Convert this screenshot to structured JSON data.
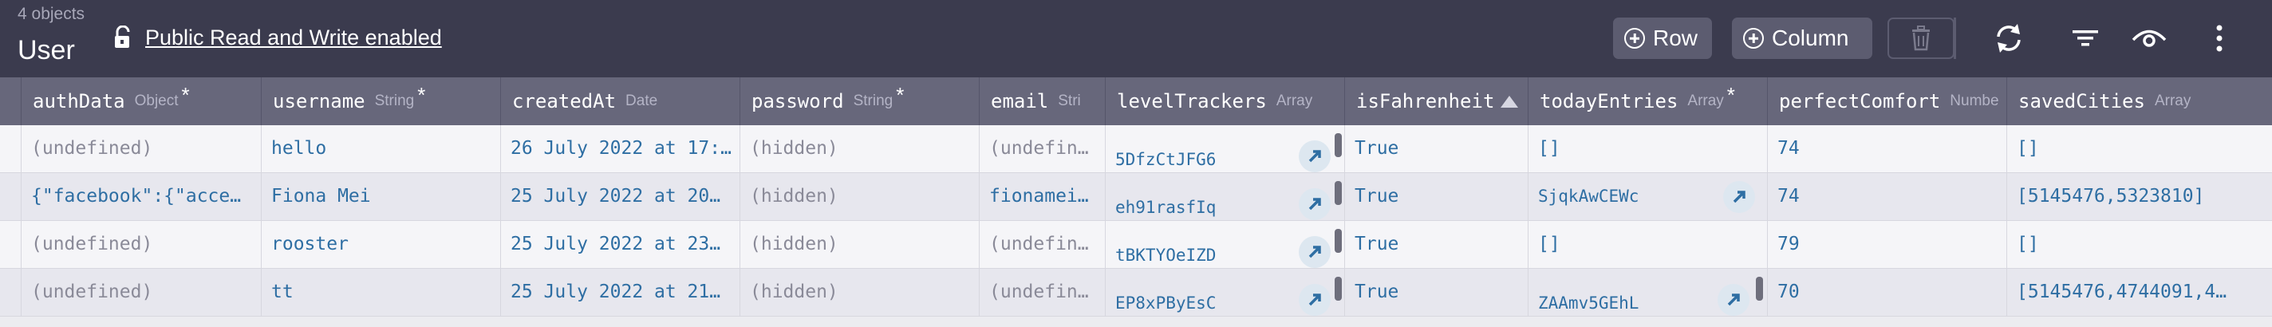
{
  "toolbar": {
    "object_count": "4 objects",
    "class_name": "User",
    "permission_label": "Public Read and Write enabled",
    "add_row_label": "Row",
    "add_column_label": "Column"
  },
  "columns": [
    {
      "name": "authData",
      "type": "Object",
      "required": "*"
    },
    {
      "name": "username",
      "type": "String",
      "required": "*"
    },
    {
      "name": "createdAt",
      "type": "Date"
    },
    {
      "name": "password",
      "type": "String",
      "required": "*"
    },
    {
      "name": "email",
      "type": "Stri"
    },
    {
      "name": "levelTrackers",
      "type": "Array"
    },
    {
      "name": "isFahrenheit",
      "sort": "ascending"
    },
    {
      "name": "todayEntries",
      "type": "Array",
      "required": "*"
    },
    {
      "name": "perfectComfort",
      "type": "Numbe"
    },
    {
      "name": "savedCities",
      "type": "Array"
    }
  ],
  "rows": [
    {
      "authData": "(undefined)",
      "username": "hello",
      "createdAt": "26 July 2022 at 17:…",
      "password": "(hidden)",
      "email": "(undefin…",
      "levelTrackers": "5DfzCtJFG6",
      "isFahrenheit": "True",
      "todayEntries": "[]",
      "perfectComfort": "74",
      "savedCities": "[]"
    },
    {
      "authData": "{\"facebook\":{\"acce…",
      "username": "Fiona Mei",
      "createdAt": "25 July 2022 at 20…",
      "password": "(hidden)",
      "email": "fionamei…",
      "levelTrackers": "eh91rasfIq",
      "isFahrenheit": "True",
      "todayEntries": "SjqkAwCEWc",
      "perfectComfort": "74",
      "savedCities": "[5145476,5323810]"
    },
    {
      "authData": "(undefined)",
      "username": "rooster",
      "createdAt": "25 July 2022 at 23…",
      "password": "(hidden)",
      "email": "(undefin…",
      "levelTrackers": "tBKTYOeIZD",
      "isFahrenheit": "True",
      "todayEntries": "[]",
      "perfectComfort": "79",
      "savedCities": "[]"
    },
    {
      "authData": "(undefined)",
      "username": "tt",
      "createdAt": "25 July 2022 at 21…",
      "password": "(hidden)",
      "email": "(undefin…",
      "levelTrackers": "EP8xPByEsC",
      "isFahrenheit": "True",
      "todayEntries": "ZAAmv5GEhL",
      "perfectComfort": "70",
      "savedCities": "[5145476,4744091,4…"
    }
  ]
}
